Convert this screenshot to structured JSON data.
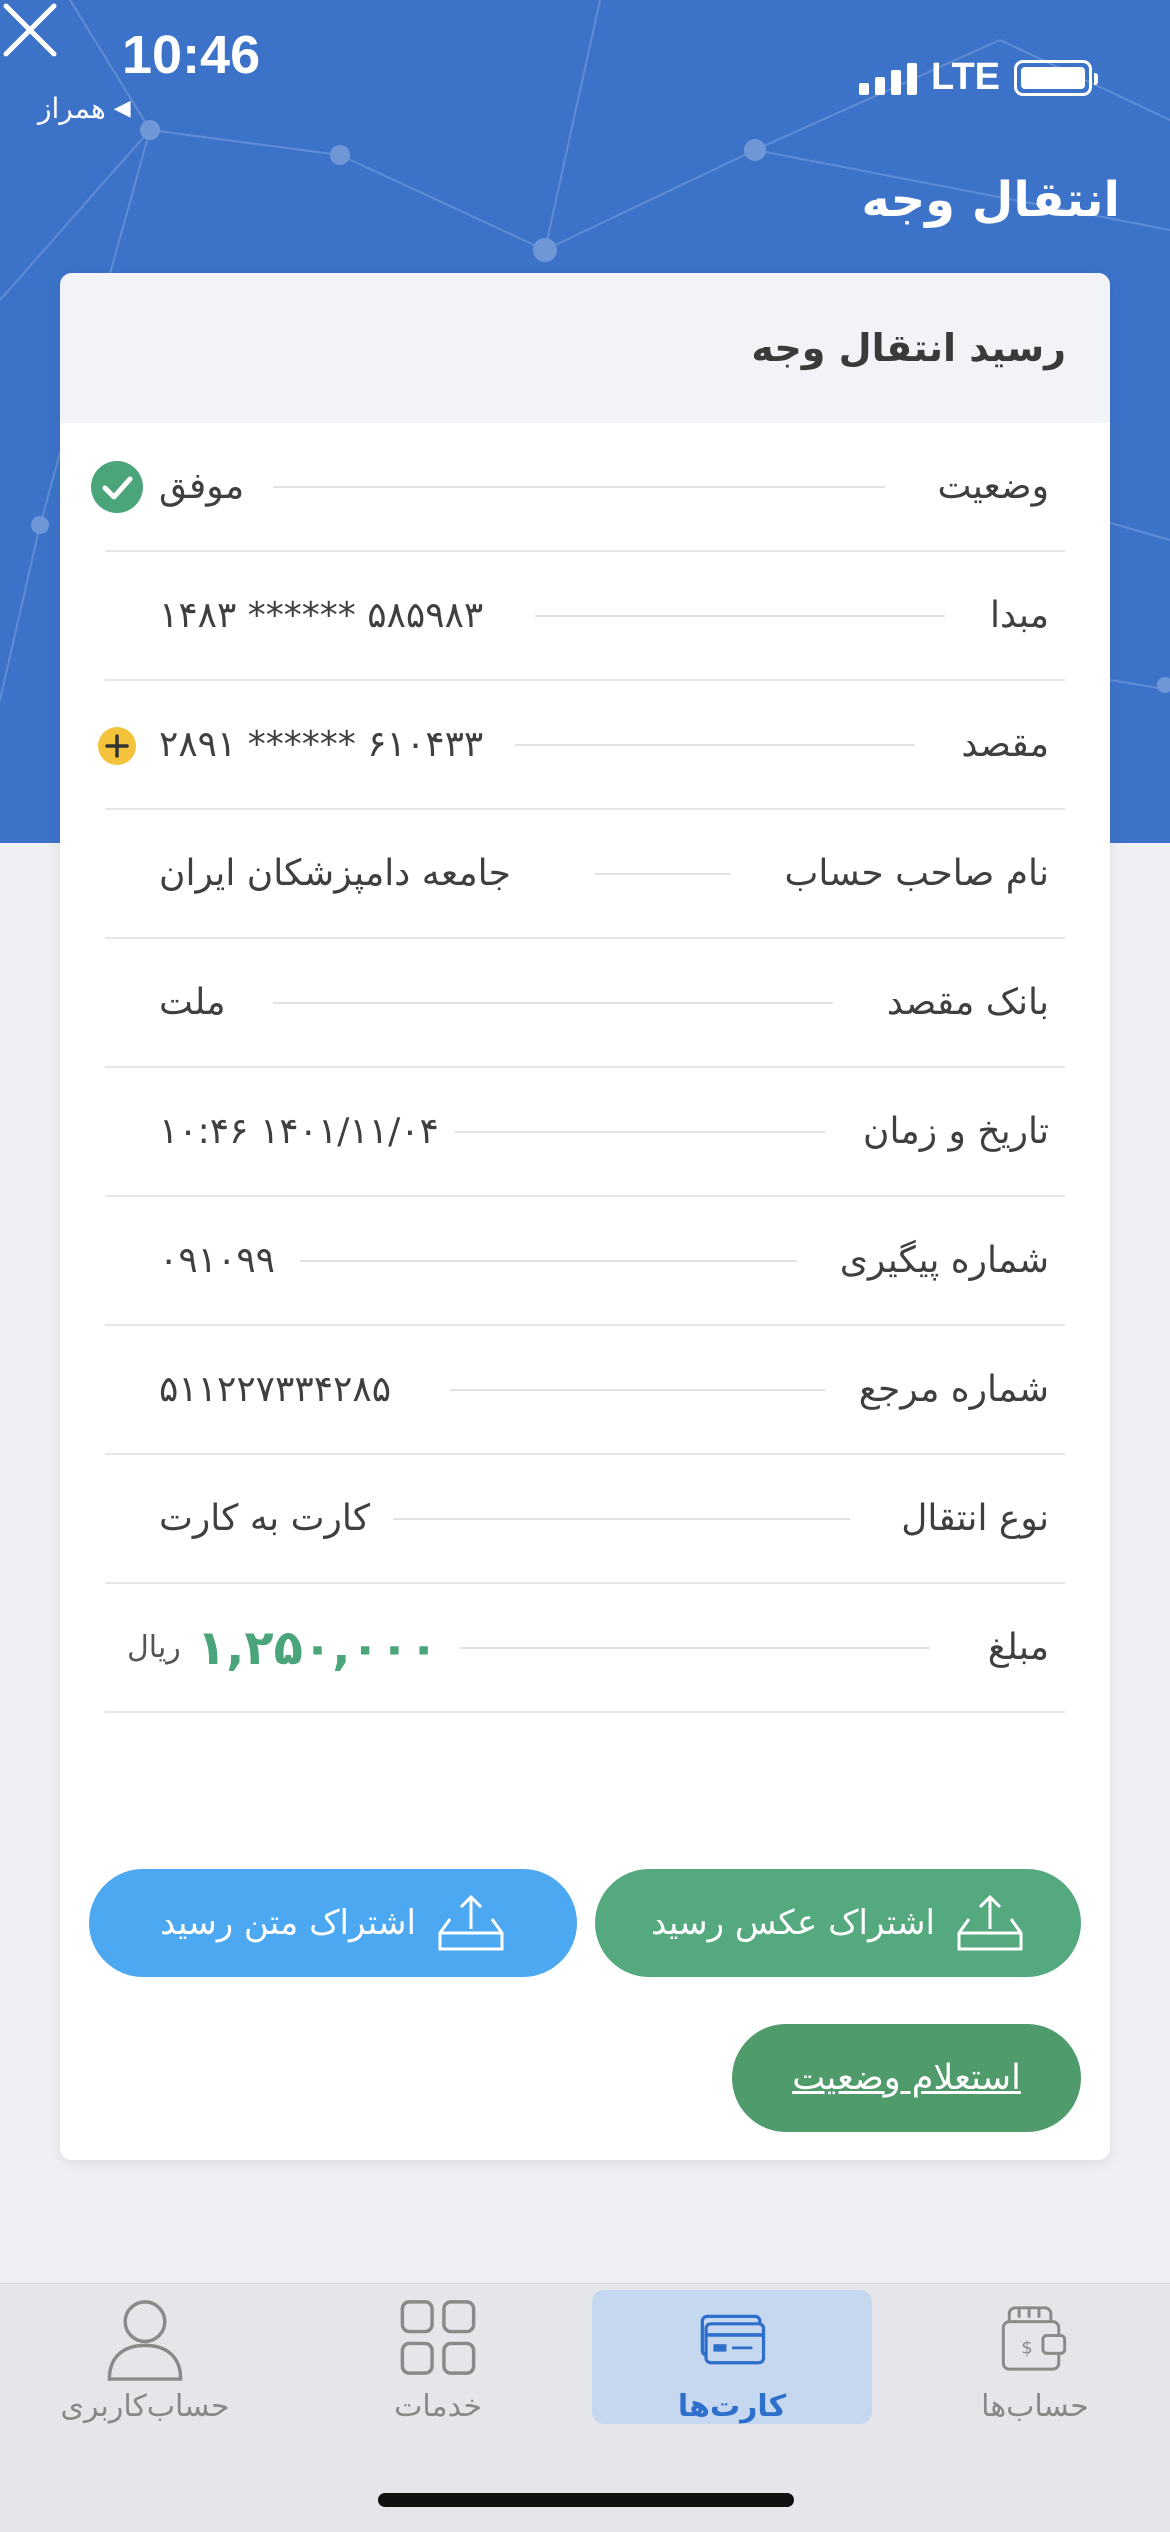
{
  "status_bar": {
    "time": "10:46",
    "carrier": "همراز",
    "network": "LTE"
  },
  "header": {
    "title": "انتقال وجه"
  },
  "receipt": {
    "title": "رسید انتقال وجه",
    "rows": [
      {
        "label": "وضعیت",
        "value": "موفق"
      },
      {
        "label": "مبدا",
        "value": "۵۸۵۹۸۳ ****** ۱۴۸۳"
      },
      {
        "label": "مقصد",
        "value": "۶۱۰۴۳۳ ****** ۲۸۹۱"
      },
      {
        "label": "نام صاحب حساب",
        "value": "جامعه دامپزشکان ایران"
      },
      {
        "label": "بانک مقصد",
        "value": "ملت"
      },
      {
        "label": "تاریخ و زمان",
        "value": "۱۴۰۱/۱۱/۰۴ ۱۰:۴۶"
      },
      {
        "label": "شماره پیگیری",
        "value": "۰۹۱۰۹۹"
      },
      {
        "label": "شماره مرجع",
        "value": "۵۱۱۲۲۷۳۳۴۲۸۵"
      },
      {
        "label": "نوع انتقال",
        "value": "کارت به کارت"
      },
      {
        "label": "مبلغ",
        "value": "۱,۲۵۰,۰۰۰",
        "unit": "ریال"
      }
    ]
  },
  "actions": {
    "share_image": "اشتراک عکس رسید",
    "share_text": "اشتراک متن رسید",
    "inquiry": "استعلام وضعیت"
  },
  "tabbar": {
    "accounts": "حساب‌ها",
    "cards": "کارت‌ها",
    "services": "خدمات",
    "profile": "حساب‌کاربری"
  },
  "colors": {
    "header_blue": "#3c73c9",
    "success_green": "#4aa57b",
    "share_text_blue": "#4ba8f1",
    "active_tab_blue": "#2f6fcc"
  },
  "icons": {
    "status": "check-circle-icon",
    "destination": "plus-circle-icon",
    "share": "share-tray-icon"
  }
}
